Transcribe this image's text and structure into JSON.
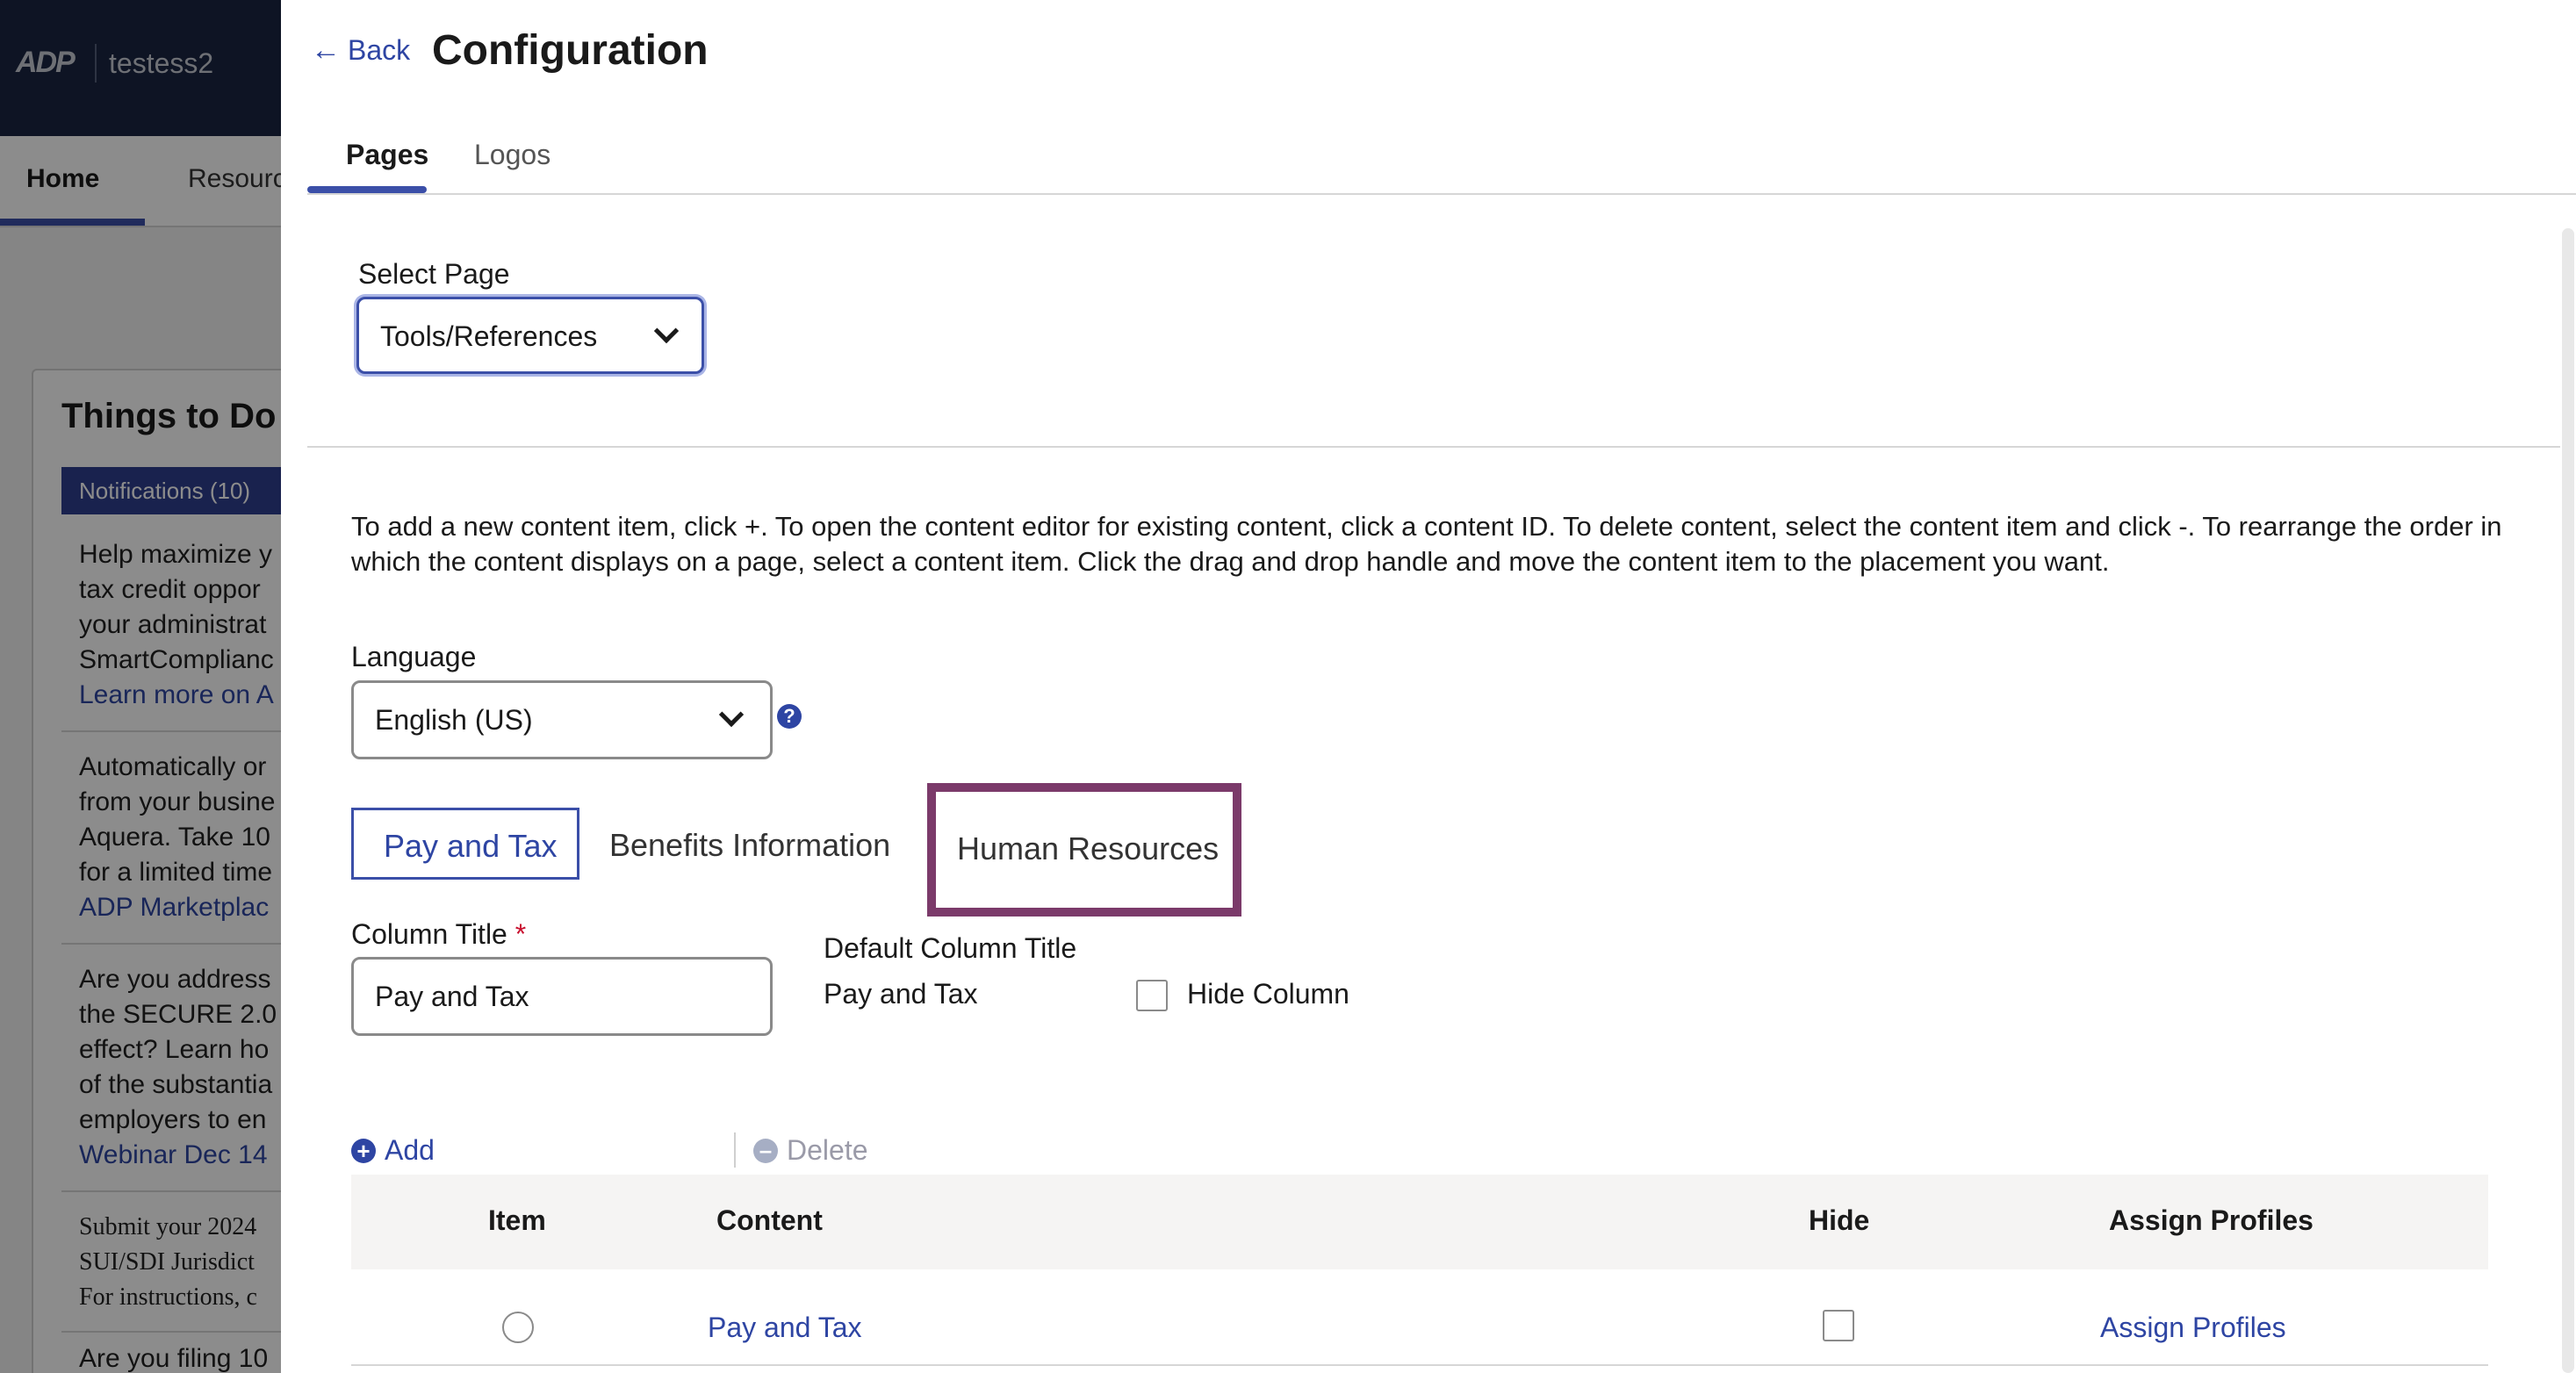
{
  "background": {
    "company": "testess2",
    "nav": {
      "home": "Home",
      "resources": "Resourc"
    },
    "card_title": "Things to Do",
    "notifications": "Notifications (10)",
    "items": [
      [
        "Help maximize y",
        "tax credit oppor",
        "your administrat",
        "SmartComplianc"
      ],
      [
        "Learn more on A"
      ],
      [
        "Automatically or",
        "from your busine",
        "Aquera. Take 10",
        "for a limited time"
      ],
      [
        "ADP Marketplac"
      ],
      [
        "Are you address",
        "the SECURE 2.0",
        "effect? Learn ho",
        "of the substantia",
        "employers to en"
      ],
      [
        "Webinar Dec 14"
      ],
      [
        "Submit your 2024",
        "SUI/SDI Jurisdict",
        "For instructions, c"
      ],
      [
        "Are you filing 10"
      ]
    ]
  },
  "header": {
    "back": "Back",
    "title": "Configuration"
  },
  "tabs": [
    {
      "label": "Pages",
      "active": true
    },
    {
      "label": "Logos",
      "active": false
    }
  ],
  "select_page": {
    "label": "Select Page",
    "value": "Tools/References"
  },
  "instructions": "To add a new content item, click +. To open the content editor for existing content, click a content ID. To delete content, select the content item and click -. To rearrange the order in which the content displays on a page, select a content item. Click the drag and drop handle and move the content item to the placement you want.",
  "language": {
    "label": "Language",
    "value": "English (US)"
  },
  "column_tabs": [
    {
      "label": "Pay and Tax",
      "active": true
    },
    {
      "label": "Benefits Information",
      "active": false
    },
    {
      "label": "Human Resources",
      "active": false,
      "highlighted": true
    }
  ],
  "column_title": {
    "label": "Column Title",
    "required_marker": "*",
    "value": "Pay and Tax"
  },
  "default_column_title": {
    "label": "Default Column Title",
    "value": "Pay and Tax"
  },
  "hide_column": {
    "label": "Hide Column",
    "checked": false
  },
  "toolbar": {
    "add": "Add",
    "delete": "Delete"
  },
  "table": {
    "headers": [
      "Item",
      "Content",
      "Hide",
      "Assign Profiles"
    ],
    "rows": [
      {
        "content": "Pay and Tax",
        "hide": false,
        "assign": "Assign Profiles"
      }
    ]
  },
  "colors": {
    "accent": "#3b4fa8",
    "link": "#2e45a3",
    "highlight_border": "#7b3a6a",
    "header_bg": "#1a2542"
  }
}
